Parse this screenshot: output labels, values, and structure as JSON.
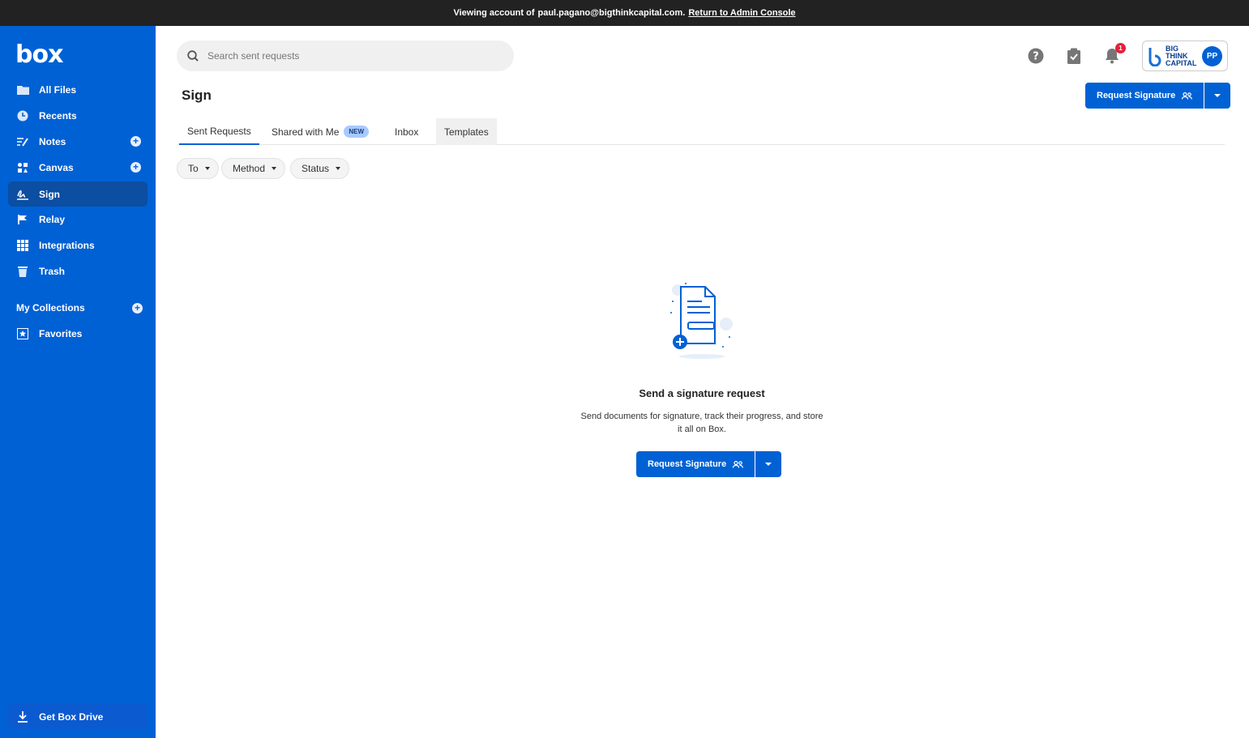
{
  "banner": {
    "prefix": "Viewing account of",
    "email": "paul.pagano@bigthinkcapital.com.",
    "link": "Return to Admin Console"
  },
  "sidebar": {
    "logo": "box",
    "items": [
      {
        "label": "All Files",
        "icon": "folder-icon"
      },
      {
        "label": "Recents",
        "icon": "clock-icon"
      },
      {
        "label": "Notes",
        "icon": "notes-icon"
      },
      {
        "label": "Canvas",
        "icon": "canvas-icon"
      },
      {
        "label": "Sign",
        "icon": "sign-icon"
      },
      {
        "label": "Relay",
        "icon": "relay-icon"
      },
      {
        "label": "Integrations",
        "icon": "grid-icon"
      },
      {
        "label": "Trash",
        "icon": "trash-icon"
      }
    ],
    "collections_label": "My Collections",
    "favorites_label": "Favorites",
    "drive_label": "Get Box Drive"
  },
  "header": {
    "search_placeholder": "Search sent requests",
    "notification_count": "1",
    "account_brand": [
      "BIG",
      "THINK",
      "CAPITAL"
    ],
    "avatar_initials": "PP"
  },
  "page": {
    "title": "Sign",
    "request_signature_label": "Request Signature"
  },
  "tabs": [
    {
      "label": "Sent Requests"
    },
    {
      "label": "Shared with Me",
      "badge": "NEW"
    },
    {
      "label": "Inbox"
    },
    {
      "label": "Templates"
    }
  ],
  "filters": [
    "To",
    "Method",
    "Status"
  ],
  "empty_state": {
    "title": "Send a signature request",
    "description": "Send documents for signature, track their progress, and store it all on Box.",
    "button_label": "Request Signature"
  },
  "colors": {
    "brand_blue": "#0061d5",
    "sidebar_active": "#0b4ea2",
    "banner_bg": "#222222",
    "badge_red": "#e3203b"
  }
}
